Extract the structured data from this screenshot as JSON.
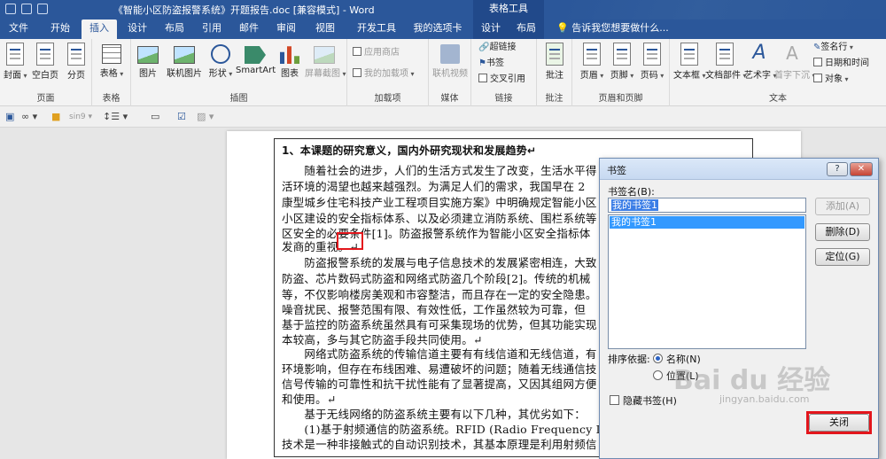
{
  "window": {
    "title": "《智能小区防盗报警系统》开题报告.doc [兼容模式] - Word",
    "context_header": "表格工具"
  },
  "tabs": [
    {
      "label": "文件"
    },
    {
      "label": "开始"
    },
    {
      "label": "插入",
      "active": true
    },
    {
      "label": "设计"
    },
    {
      "label": "布局"
    },
    {
      "label": "引用"
    },
    {
      "label": "邮件"
    },
    {
      "label": "审阅"
    },
    {
      "label": "视图"
    },
    {
      "label": "开发工具"
    },
    {
      "label": "我的选项卡"
    },
    {
      "label": "设计"
    },
    {
      "label": "布局"
    }
  ],
  "tell_me": "告诉我您想要做什么...",
  "ribbon": {
    "groups": {
      "pages": "页面",
      "tables": "表格",
      "illustrations": "插图",
      "addins": "加载项",
      "media": "媒体",
      "links": "链接",
      "comments": "批注",
      "header_footer": "页眉和页脚",
      "text": "文本"
    },
    "buttons": {
      "cover": "封面",
      "blank_page": "空白页",
      "page_break": "分页",
      "table": "表格",
      "picture": "图片",
      "online_picture": "联机图片",
      "shapes": "形状",
      "smartart": "SmartArt",
      "chart": "图表",
      "screenshot": "屏幕截图",
      "store": "应用商店",
      "my_addins": "我的加载项",
      "online_video": "联机视频",
      "hyperlink": "超链接",
      "bookmark": "书签",
      "cross_ref": "交叉引用",
      "comment": "批注",
      "header": "页眉",
      "footer": "页脚",
      "page_number": "页码",
      "textbox": "文本框",
      "doc_parts": "文档部件",
      "wordart": "艺术字",
      "drop_cap": "首字下沉",
      "signature": "签名行",
      "datetime": "日期和时间",
      "object": "对象"
    }
  },
  "quick_access": {
    "style_label": "sin9"
  },
  "document": {
    "lines": [
      "1、本课题的研究意义，国内外研究现状和发展趋势↵",
      "　　随着社会的进步，人们的生活方式发生了改变，生活水平得",
      "活环境的渴望也越来越强烈。为满足人们的需求，我国早在 2",
      "康型城乡住宅科技产业工程项目实施方案》中明确规定智能小区",
      "小区建设的安全指标体系、以及必须建立消防系统、围栏系统等",
      "区安全的必要条件[1]。防盗报警系统作为智能小区安全指标体",
      "发商的重视。↵",
      "　　防盗报警系统的发展与电子信息技术的发展紧密相连，大致",
      "防盗、芯片数码式防盗和网络式防盗几个阶段[2]。传统的机械",
      "等，不仅影响楼房美观和市容整洁，而且存在一定的安全隐患。",
      "噪音扰民、报警范围有限、有效性低，工作虽然较为可靠，但",
      "基于监控的防盗系统虽然具有可采集现场的优势，但其功能实现",
      "本较高，多与其它防盗手段共同使用。↵",
      "　　网络式防盗系统的传输信道主要有有线信道和无线信道，有",
      "环境影响，但存在布线困难、易遭破坏的问题；随着无线通信技",
      "信号传输的可靠性和抗干扰性能有了显著提高，又因其组网方便",
      "和使用。↵",
      "　　基于无线网络的防盗系统主要有以下几种，其优劣如下：",
      "　　(1)基于射频通信的防盗系统。RFID (Radio Frequency I",
      "技术是一种非接触式的自动识别技术，其基本原理是利用射频信"
    ]
  },
  "dialog": {
    "title": "书签",
    "help": "?",
    "close_x": "✕",
    "name_label": "书签名(B):",
    "name_value": "我的书签1",
    "list_items": [
      "我的书签1"
    ],
    "add": "添加(A)",
    "delete": "删除(D)",
    "goto": "定位(G)",
    "sort_label": "排序依据:",
    "sort_name": "名称(N)",
    "sort_location": "位置(L)",
    "hidden_label": "隐藏书签(H)",
    "close": "关闭"
  },
  "watermark": {
    "brand": "Bai du 经验",
    "url": "jingyan.baidu.com"
  }
}
